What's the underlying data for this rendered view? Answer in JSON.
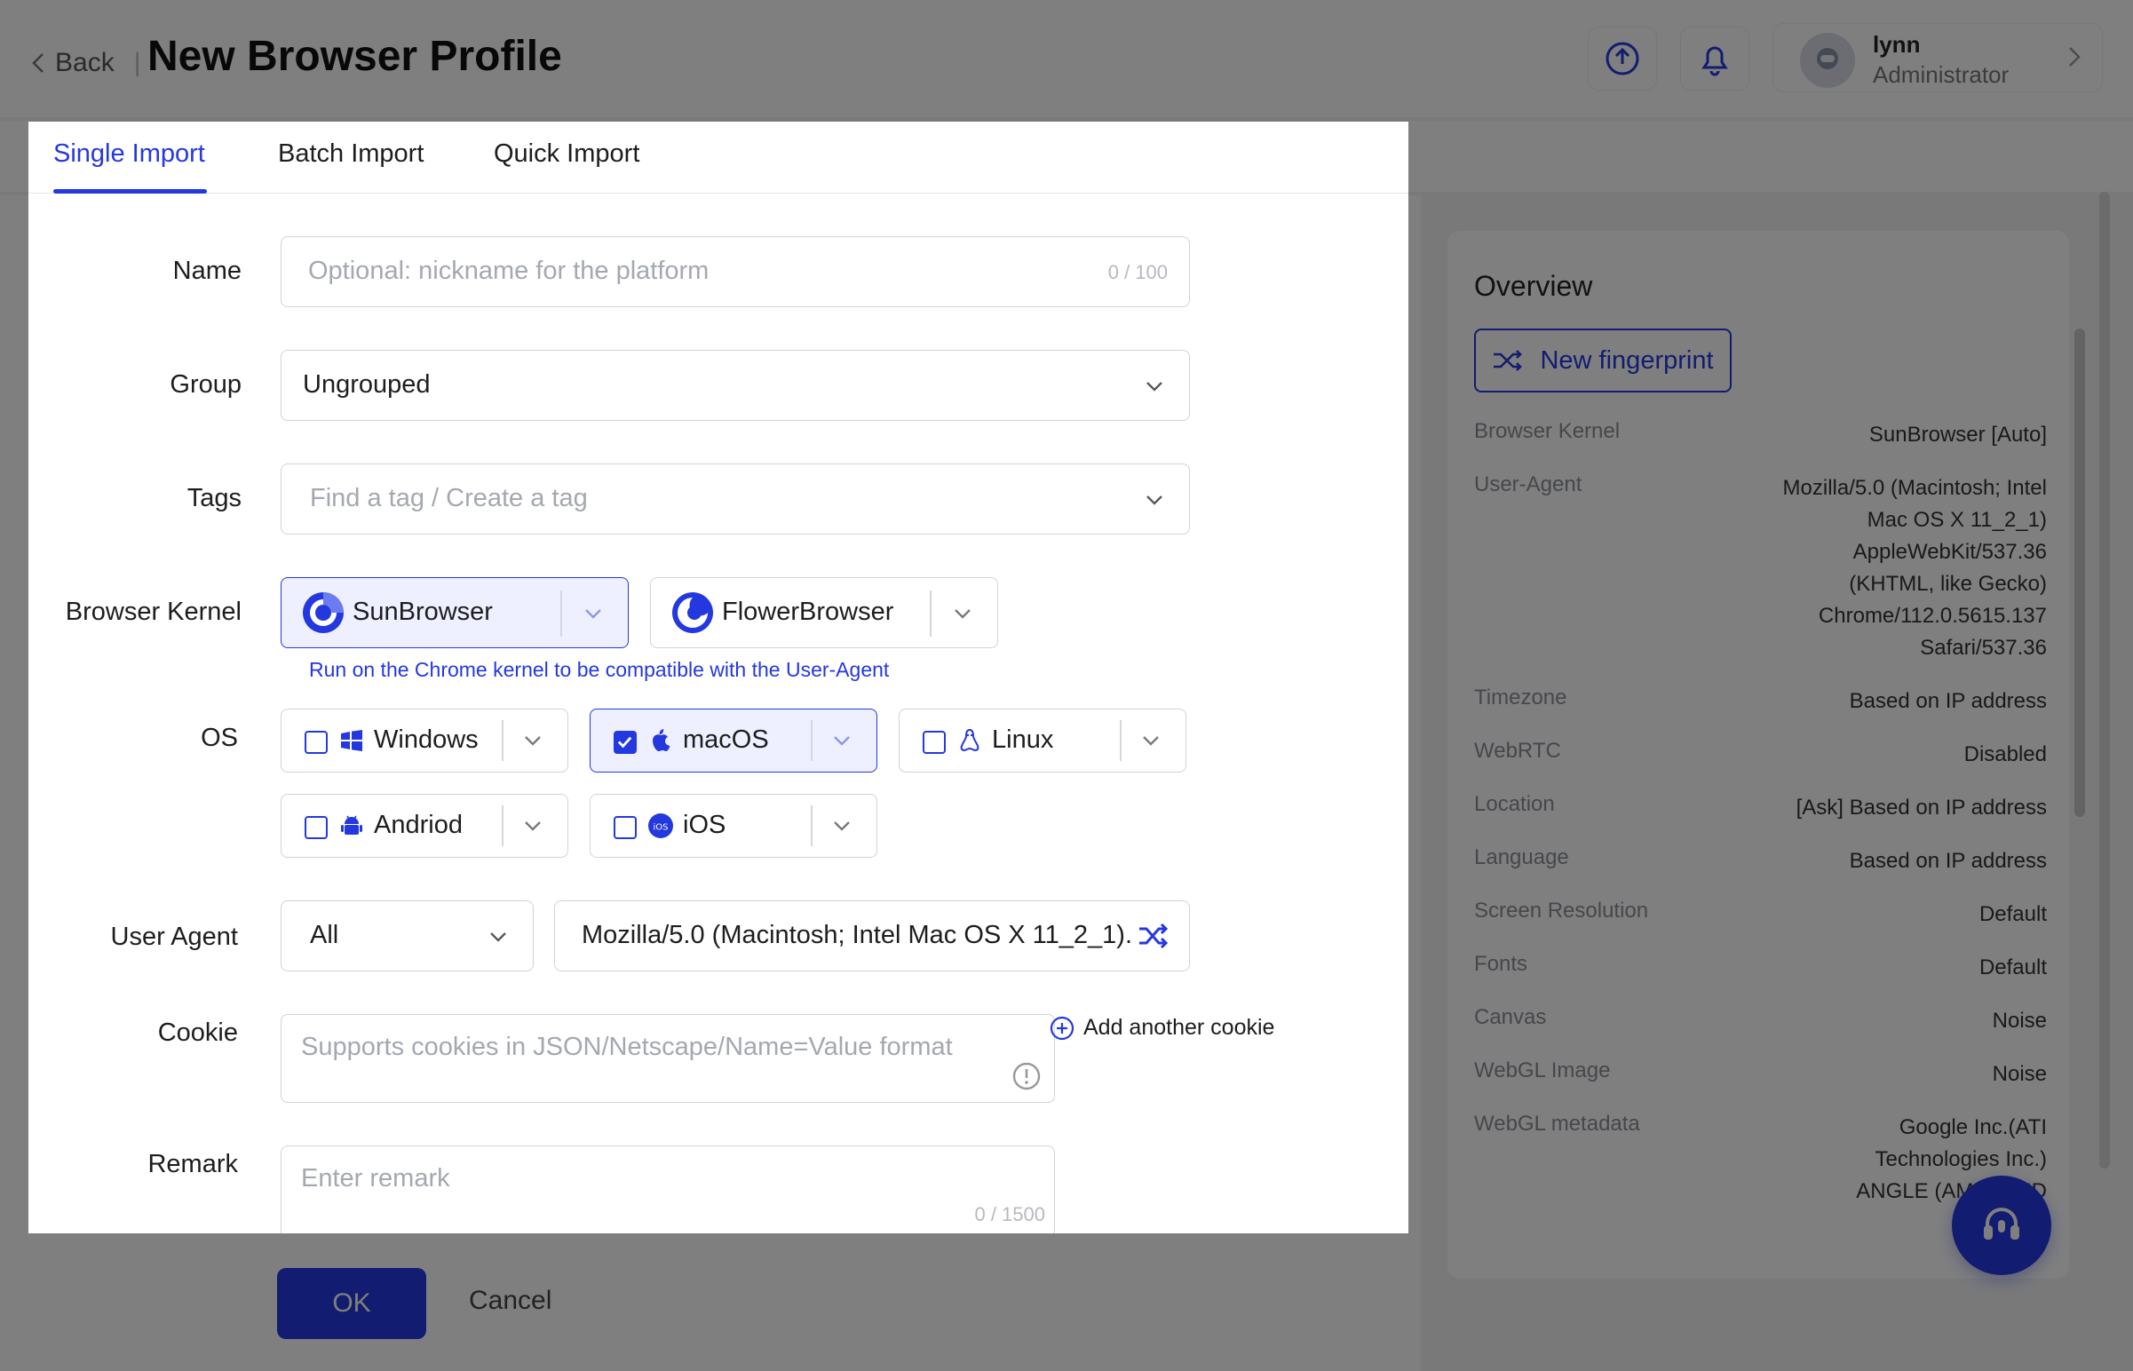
{
  "header": {
    "back_label": "Back",
    "title": "New Browser Profile",
    "user": {
      "name": "lynn",
      "role": "Administrator"
    }
  },
  "tabs": [
    {
      "label": "Single Import",
      "active": true
    },
    {
      "label": "Batch Import",
      "active": false
    },
    {
      "label": "Quick Import",
      "active": false
    }
  ],
  "form": {
    "name": {
      "label": "Name",
      "placeholder": "Optional: nickname for the platform",
      "counter": "0 / 100"
    },
    "group": {
      "label": "Group",
      "value": "Ungrouped"
    },
    "tags": {
      "label": "Tags",
      "placeholder": "Find a tag / Create a tag"
    },
    "kernel": {
      "label": "Browser Kernel",
      "options": [
        {
          "name": "SunBrowser",
          "selected": true
        },
        {
          "name": "FlowerBrowser",
          "selected": false
        }
      ],
      "hint": "Run on the Chrome kernel to be compatible with the User-Agent"
    },
    "os": {
      "label": "OS",
      "options": [
        {
          "name": "Windows",
          "icon": "windows-icon",
          "checked": false
        },
        {
          "name": "macOS",
          "icon": "apple-icon",
          "checked": true
        },
        {
          "name": "Linux",
          "icon": "linux-icon",
          "checked": false
        },
        {
          "name": "Andriod",
          "icon": "android-icon",
          "checked": false
        },
        {
          "name": "iOS",
          "icon": "ios-icon",
          "checked": false
        }
      ]
    },
    "user_agent": {
      "label": "User Agent",
      "filter": "All",
      "value": "Mozilla/5.0 (Macintosh; Intel Mac OS X 11_2_1)..."
    },
    "cookie": {
      "label": "Cookie",
      "placeholder": "Supports cookies in JSON/Netscape/Name=Value format",
      "add_label": "Add another cookie"
    },
    "remark": {
      "label": "Remark",
      "placeholder": "Enter remark",
      "counter": "0 / 1500"
    }
  },
  "footer": {
    "ok_label": "OK",
    "cancel_label": "Cancel"
  },
  "overview": {
    "title": "Overview",
    "new_fingerprint_label": "New fingerprint",
    "rows": [
      {
        "label": "Browser Kernel",
        "value": "SunBrowser [Auto]"
      },
      {
        "label": "User-Agent",
        "value_lines": [
          "Mozilla/5.0 (Macintosh; Intel",
          "Mac OS X 11_2_1)",
          "AppleWebKit/537.36",
          "(KHTML, like Gecko)",
          "Chrome/112.0.5615.137",
          "Safari/537.36"
        ]
      },
      {
        "label": "Timezone",
        "value": "Based on IP address"
      },
      {
        "label": "WebRTC",
        "value": "Disabled"
      },
      {
        "label": "Location",
        "value": "[Ask] Based on IP address"
      },
      {
        "label": "Language",
        "value": "Based on IP address"
      },
      {
        "label": "Screen Resolution",
        "value": "Default"
      },
      {
        "label": "Fonts",
        "value": "Default"
      },
      {
        "label": "Canvas",
        "value": "Noise"
      },
      {
        "label": "WebGL Image",
        "value": "Noise"
      },
      {
        "label": "WebGL metadata",
        "value_lines": [
          "Google Inc.(ATI",
          "Technologies Inc.)",
          "ANGLE (AMD, AMD"
        ]
      }
    ]
  },
  "colors": {
    "accent": "#2438e0",
    "overlay": "rgba(0,0,0,0.5)"
  }
}
